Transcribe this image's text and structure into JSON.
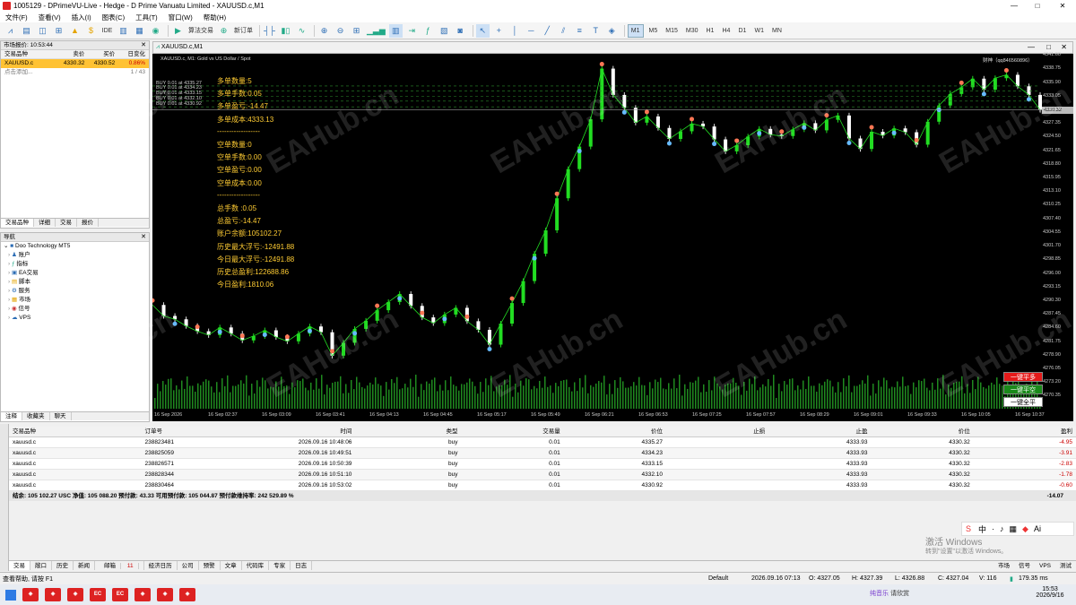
{
  "window": {
    "title": "1005129 - DPrimeVU-Live - Hedge - D Prime Vanuatu Limited - XAUUSD.c,M1"
  },
  "menu": [
    "文件(F)",
    "查看(V)",
    "插入(I)",
    "图表(C)",
    "工具(T)",
    "窗口(W)",
    "帮助(H)"
  ],
  "toolbar": {
    "ide": "IDE",
    "algo": "算法交易",
    "new_order": "新订单",
    "timeframes": [
      "M1",
      "M5",
      "M15",
      "M30",
      "H1",
      "H4",
      "D1",
      "W1",
      "MN"
    ],
    "active_tf": "M1"
  },
  "market_watch": {
    "header": "市场报价: 10:53:44",
    "cols": [
      "交易品种",
      "卖价",
      "买价",
      "日变化"
    ],
    "row": {
      "symbol": "XAUUSD.c",
      "bid": "4330.32",
      "ask": "4330.52",
      "change": "0.86%"
    },
    "add": "点击添加...",
    "count": "1 / 43",
    "tabs": [
      "交易品种",
      "详细",
      "交易",
      "报价"
    ]
  },
  "navigator": {
    "header": "导航",
    "root": "Doo Technology MT5",
    "items": [
      "账户",
      "指标",
      "EA交易",
      "脚本",
      "服务",
      "市场",
      "信号",
      "VPS"
    ],
    "tabs": [
      "注释",
      "收藏夹",
      "聊天"
    ]
  },
  "chart": {
    "tab": "XAUUSD.c,M1",
    "info": "XAUUSD.c, M1:  Gold vs US Dollar / Spot",
    "account_label": "财神（qq846560896）",
    "buy_lines": [
      "BUY 0.01 at 4335.27",
      "BUY 0.01 at 4334.23",
      "BUY 0.01 at 4333.15",
      "BUY 0.01 at 4332.10",
      "BUY 0.01 at 4330.92"
    ],
    "stats": [
      "多单数量:5",
      "多单手数:0.05",
      "多单盈亏:-14.47",
      "多单成本:4333.13",
      "------------------",
      "空单数量:0",
      "空单手数:0.00",
      "空单盈亏:0.00",
      "空单成本:0.00",
      "------------------",
      "总手数 :0.05",
      "总盈亏:-14.47",
      "账户余额:105102.27",
      "历史最大浮亏:-12491.88",
      "今日最大浮亏:-12491.88",
      "历史总盈利:122688.86",
      "今日盈利:1810.06"
    ],
    "price_label": "4330.32",
    "buttons": [
      "一键平多",
      "一键平空",
      "一键全平"
    ],
    "watermark": "EAHub.cn"
  },
  "chart_data": {
    "type": "line",
    "title": "XAUUSD.c, M1:  Gold vs US Dollar / Spot",
    "xlabel": "",
    "ylabel": "",
    "x_ticks": [
      "16 Sep 2026",
      "16 Sep 02:37",
      "16 Sep 03:09",
      "16 Sep 03:41",
      "16 Sep 04:13",
      "16 Sep 04:45",
      "16 Sep 05:17",
      "16 Sep 05:49",
      "16 Sep 06:21",
      "16 Sep 06:53",
      "16 Sep 07:25",
      "16 Sep 07:57",
      "16 Sep 08:29",
      "16 Sep 09:01",
      "16 Sep 09:33",
      "16 Sep 10:05",
      "16 Sep 10:37"
    ],
    "y_ticks": [
      "4341.60",
      "4338.75",
      "4335.90",
      "4333.05",
      "4330.20",
      "4327.35",
      "4324.50",
      "4321.65",
      "4318.80",
      "4315.95",
      "4313.10",
      "4310.25",
      "4307.40",
      "4304.55",
      "4301.70",
      "4298.85",
      "4296.00",
      "4293.15",
      "4290.30",
      "4287.45",
      "4284.60",
      "4281.75",
      "4278.90",
      "4276.05",
      "4273.20",
      "4270.35"
    ],
    "ylim": [
      4268,
      4342
    ],
    "series": [
      {
        "values": [
          4289.5,
          4287.2,
          4286.5,
          4285.1,
          4284.0,
          4283.2,
          4284.8,
          4283.5,
          4282.1,
          4283.0,
          4284.2,
          4282.8,
          4281.9,
          4283.5,
          4285.0,
          4283.8,
          4278.9,
          4281.6,
          4284.5,
          4286.2,
          4288.4,
          4290.1,
          4291.8,
          4289.3,
          4286.9,
          4285.7,
          4287.5,
          4288.9,
          4286.1,
          4284.3,
          4281.2,
          4285.6,
          4289.9,
          4294.5,
          4300.2,
          4305.1,
          4311.8,
          4317.9,
          4322.6,
          4328.3,
          4338.9,
          4333.4,
          4330.7,
          4327.6,
          4328.9,
          4326.5,
          4324.2,
          4325.8,
          4327.4,
          4326.8,
          4324.1,
          4321.6,
          4322.9,
          4324.7,
          4326.3,
          4325.1,
          4324.8,
          4326.2,
          4327.5,
          4326.0,
          4328.2,
          4329.1,
          4324.3,
          4322.1,
          4325.7,
          4324.9,
          4326.4,
          4325.6,
          4323.0,
          4327.8,
          4331.2,
          4333.6,
          4335.0,
          4336.8,
          4334.5,
          4336.9,
          4337.6,
          4335.2,
          4333.4,
          4330.3
        ]
      }
    ]
  },
  "orders": {
    "cols": [
      "交易品种",
      "订单号",
      "时间",
      "类型",
      "交易量",
      "价位",
      "止损",
      "止盈",
      "价位",
      "盈利"
    ],
    "rows": [
      [
        "xauusd.c",
        "238823481",
        "2026.09.16 10:48:06",
        "buy",
        "0.01",
        "4335.27",
        "",
        "4333.93",
        "4330.32",
        "-4.95"
      ],
      [
        "xauusd.c",
        "238825059",
        "2026.09.16 10:49:51",
        "buy",
        "0.01",
        "4334.23",
        "",
        "4333.93",
        "4330.32",
        "-3.91"
      ],
      [
        "xauusd.c",
        "238826571",
        "2026.09.16 10:50:39",
        "buy",
        "0.01",
        "4333.15",
        "",
        "4333.93",
        "4330.32",
        "-2.83"
      ],
      [
        "xauusd.c",
        "238828344",
        "2026.09.16 10:51:10",
        "buy",
        "0.01",
        "4332.10",
        "",
        "4333.93",
        "4330.32",
        "-1.78"
      ],
      [
        "xauusd.c",
        "238830464",
        "2026.09.16 10:53:02",
        "buy",
        "0.01",
        "4330.92",
        "",
        "4333.93",
        "4330.32",
        "-0.60"
      ]
    ],
    "summary": "结余: 105 102.27 USC  净值: 105 088.20  预付款: 43.33  可用预付款: 105 044.87  预付款维持率: 242 529.89 %",
    "summary_total": "-14.07"
  },
  "bottom_tabs": [
    "交易",
    "敞口",
    "历史",
    "新闻",
    "邮箱",
    "经济日历",
    "公司",
    "预警",
    "文章",
    "代码库",
    "专家",
    "日志"
  ],
  "mail_count": "11",
  "activation": [
    "激活 Windows",
    "转到\"设置\"以激活 Windows。"
  ],
  "ime": [
    "中",
    "·",
    "Ai"
  ],
  "status": {
    "help": "查看帮助, 请按 F1",
    "profile": "Default",
    "time": "2026.09.16 07:13",
    "open": "O: 4327.05",
    "high": "H: 4327.39",
    "low": "L: 4326.88",
    "close": "C: 4327.04",
    "volume": "V: 116",
    "net": "179.35 ms",
    "right_tabs": [
      "市场",
      "信号",
      "VPS",
      "测试"
    ]
  },
  "taskbar": {
    "news": "纯音乐",
    "weather": "请欣赏",
    "clock_time": "15:53",
    "clock_date": "2026/9/16"
  }
}
